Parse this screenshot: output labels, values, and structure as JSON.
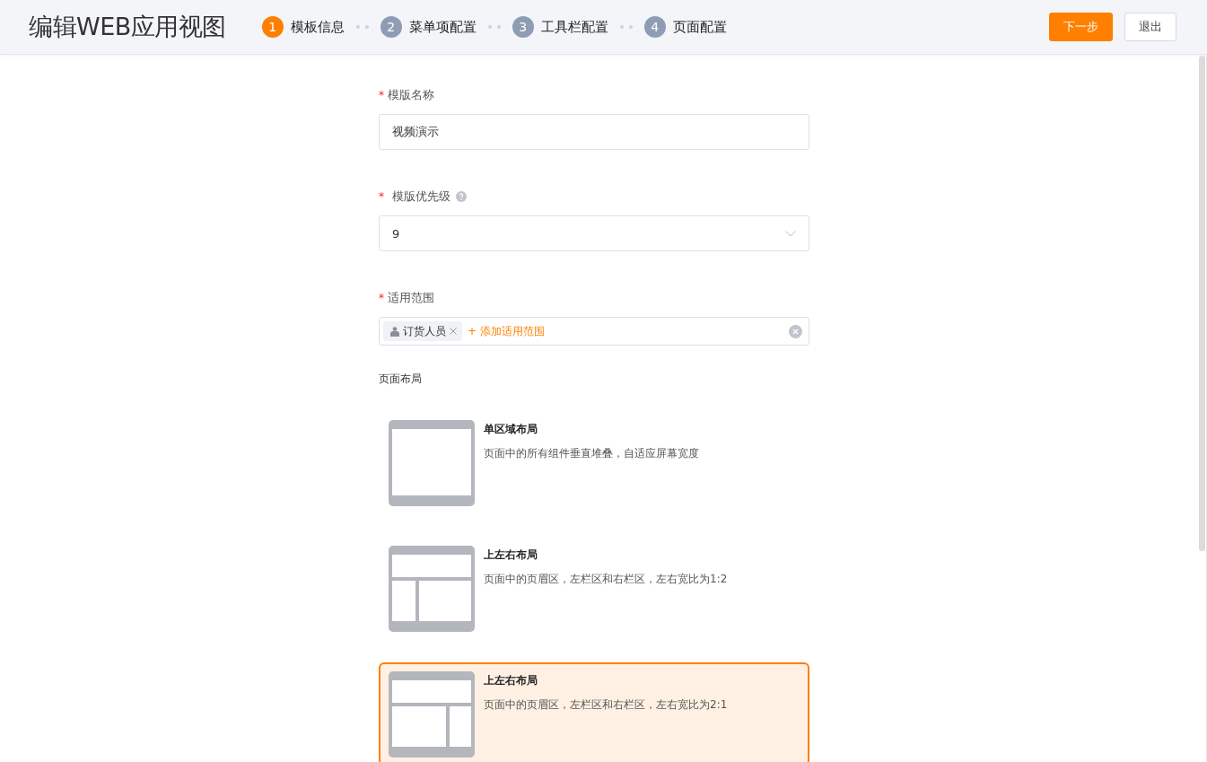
{
  "header": {
    "title": "编辑WEB应用视图",
    "steps": [
      {
        "number": "1",
        "label": "模板信息",
        "selected": true
      },
      {
        "number": "2",
        "label": "菜单项配置",
        "selected": false
      },
      {
        "number": "3",
        "label": "工具栏配置",
        "selected": false
      },
      {
        "number": "4",
        "label": "页面配置",
        "selected": false
      }
    ],
    "buttons": [
      {
        "label": "下一步",
        "kind": "primary"
      },
      {
        "label": "退出",
        "kind": "default"
      }
    ]
  },
  "form": {
    "fields": [
      {
        "kind": "text",
        "required_mark": "*",
        "label": "模版名称",
        "value": "视频演示"
      },
      {
        "kind": "select",
        "required_mark": "*",
        "label": "模版优先级",
        "help": true,
        "value": "9"
      },
      {
        "kind": "tags",
        "required_mark": "*",
        "label": "适用范围",
        "tags": [
          "订货人员"
        ],
        "add_link": "+ 添加适用范围"
      }
    ],
    "layout_section": {
      "label": "页面布局",
      "options": [
        {
          "kind": "single",
          "title": "单区域布局",
          "description": "页面中的所有组件垂直堆叠，自适应屏幕宽度",
          "selected": false
        },
        {
          "kind": "split-1-2",
          "title": "上左右布局",
          "description": "页面中的页眉区，左栏区和右栏区，左右宽比为1:2",
          "selected": false
        },
        {
          "kind": "split-2-1",
          "title": "上左右布局",
          "description": "页面中的页眉区，左栏区和右栏区，左右宽比为2:1",
          "selected": true
        }
      ]
    }
  }
}
